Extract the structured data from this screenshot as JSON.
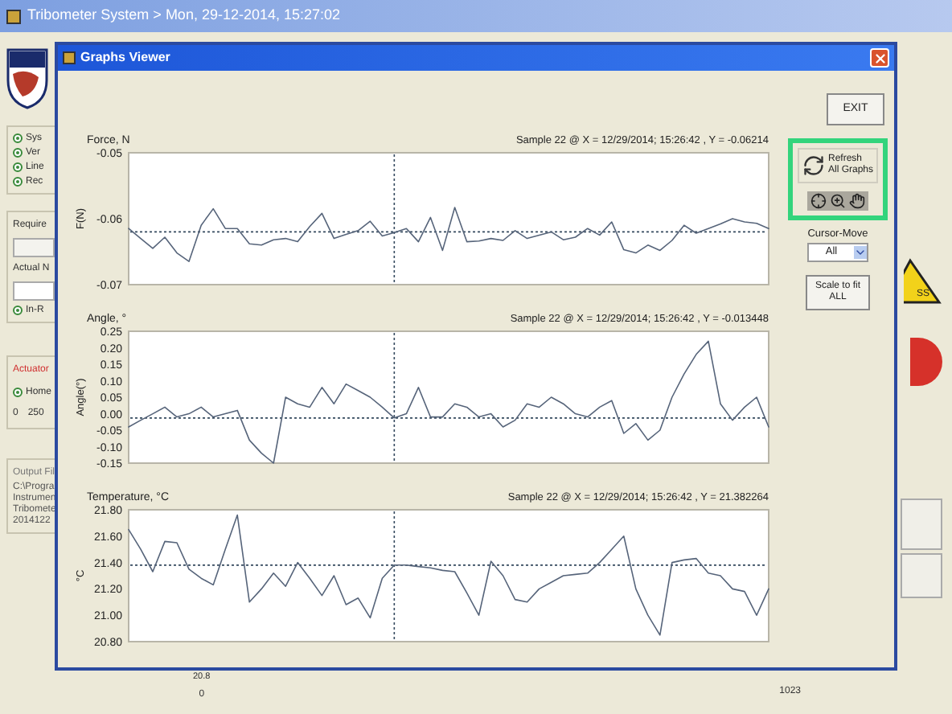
{
  "app_window": {
    "title": "Tribometer System > Mon, 29-12-2014, 15:27:02"
  },
  "background": {
    "status_options": [
      {
        "label": "Sys"
      },
      {
        "label": "Ver"
      },
      {
        "label": "Line"
      },
      {
        "label": "Rec"
      }
    ],
    "required_label": "Require",
    "actual_label": "Actual N",
    "in_range_option": "In-R",
    "actuator_label": "Actuator",
    "home_option": "Home",
    "slider_ticks": [
      "0",
      "250"
    ],
    "output_file_label": "Output Fil",
    "output_path_lines": [
      "C:\\Progra",
      "Instrumen",
      "Tribomete",
      "2014122"
    ],
    "warning_text": "SS",
    "bottom_axis_value": "20.8",
    "bottom_ticks": [
      "0",
      "1023"
    ]
  },
  "dialog": {
    "title": "Graphs Viewer",
    "graphs": [
      {
        "cursor_readout": "Sample 22 @ X = 12/29/2014; 15:26:42 , Y = -0.06214",
        "chart_data": {
          "type": "line",
          "title": "Force, N",
          "ylabel": "F(N)",
          "ylim": [
            -0.07,
            -0.05
          ],
          "yticks": [
            {
              "value": -0.07,
              "label": "-0.07"
            },
            {
              "value": -0.06,
              "label": "-0.06"
            },
            {
              "value": -0.05,
              "label": "-0.05"
            }
          ],
          "series": [
            {
              "color": "#56647a",
              "values": [
                -0.0615,
                -0.063,
                -0.0645,
                -0.0628,
                -0.0652,
                -0.0665,
                -0.061,
                -0.0585,
                -0.0615,
                -0.0615,
                -0.0638,
                -0.064,
                -0.0632,
                -0.063,
                -0.0635,
                -0.0612,
                -0.0592,
                -0.063,
                -0.0624,
                -0.0618,
                -0.0604,
                -0.0626,
                -0.0621,
                -0.0615,
                -0.0635,
                -0.0598,
                -0.0648,
                -0.0583,
                -0.0635,
                -0.0634,
                -0.063,
                -0.0633,
                -0.0618,
                -0.063,
                -0.0625,
                -0.062,
                -0.0632,
                -0.0628,
                -0.0615,
                -0.0625,
                -0.0605,
                -0.0647,
                -0.0652,
                -0.064,
                -0.0648,
                -0.0633,
                -0.061,
                -0.0622,
                -0.0615,
                -0.0608,
                -0.06,
                -0.0605,
                -0.0607,
                -0.0615
              ]
            }
          ],
          "ref_lines": [
            {
              "axis": "y",
              "value": -0.062
            }
          ]
        }
      },
      {
        "cursor_readout": "Sample 22 @ X = 12/29/2014; 15:26:42 , Y = -0.013448",
        "chart_data": {
          "type": "line",
          "title": "Angle, °",
          "ylabel": "Angle(°)",
          "ylim": [
            -0.15,
            0.25
          ],
          "yticks": [
            {
              "value": -0.15,
              "label": "-0.15"
            },
            {
              "value": -0.1,
              "label": "-0.10"
            },
            {
              "value": -0.05,
              "label": "-0.05"
            },
            {
              "value": 0,
              "label": "0.00"
            },
            {
              "value": 0.05,
              "label": "0.05"
            },
            {
              "value": 0.1,
              "label": "0.10"
            },
            {
              "value": 0.15,
              "label": "0.15"
            },
            {
              "value": 0.2,
              "label": "0.20"
            },
            {
              "value": 0.25,
              "label": "0.25"
            }
          ],
          "series": [
            {
              "color": "#56647a",
              "values": [
                -0.04,
                -0.02,
                0.0,
                0.02,
                -0.01,
                0.0,
                0.02,
                -0.01,
                0.0,
                0.01,
                -0.08,
                -0.12,
                -0.15,
                0.05,
                0.03,
                0.02,
                0.08,
                0.03,
                0.09,
                0.07,
                0.05,
                0.02,
                -0.013,
                0.0,
                0.08,
                -0.01,
                -0.01,
                0.03,
                0.02,
                -0.01,
                0.0,
                -0.04,
                -0.02,
                0.03,
                0.02,
                0.05,
                0.03,
                0.0,
                -0.01,
                0.02,
                0.04,
                -0.06,
                -0.03,
                -0.08,
                -0.05,
                0.05,
                0.12,
                0.18,
                0.22,
                0.03,
                -0.02,
                0.02,
                0.05,
                -0.04
              ]
            }
          ],
          "ref_lines": [
            {
              "axis": "y",
              "value": -0.013
            }
          ]
        }
      },
      {
        "cursor_readout": "Sample 22 @ X = 12/29/2014; 15:26:42 , Y = 21.382264",
        "chart_data": {
          "type": "line",
          "title": "Temperature, °C",
          "ylabel": "°C",
          "ylim": [
            20.8,
            21.8
          ],
          "yticks": [
            {
              "value": 20.8,
              "label": "20.80"
            },
            {
              "value": 21,
              "label": "21.00"
            },
            {
              "value": 21.2,
              "label": "21.20"
            },
            {
              "value": 21.4,
              "label": "21.40"
            },
            {
              "value": 21.6,
              "label": "21.60"
            },
            {
              "value": 21.8,
              "label": "21.80"
            }
          ],
          "series": [
            {
              "color": "#56647a",
              "values": [
                21.65,
                21.5,
                21.33,
                21.56,
                21.55,
                21.35,
                21.28,
                21.23,
                21.5,
                21.76,
                21.1,
                21.2,
                21.32,
                21.22,
                21.4,
                21.28,
                21.15,
                21.3,
                21.08,
                21.13,
                20.98,
                21.28,
                21.38,
                21.38,
                21.37,
                21.36,
                21.34,
                21.33,
                21.17,
                21.0,
                21.41,
                21.3,
                21.12,
                21.1,
                21.2,
                21.25,
                21.3,
                21.31,
                21.32,
                21.4,
                21.5,
                21.6,
                21.2,
                21.0,
                20.85,
                21.4,
                21.42,
                21.43,
                21.32,
                21.3,
                21.2,
                21.18,
                21.0,
                21.2
              ]
            }
          ],
          "ref_lines": [
            {
              "axis": "y",
              "value": 21.38
            }
          ]
        }
      }
    ],
    "panel": {
      "exit_button": "EXIT",
      "refresh_button": [
        "Refresh",
        "All Graphs"
      ],
      "cursor_move_label": "Cursor-Move",
      "cursor_move_value": "All",
      "scale_button": [
        "Scale to fit",
        "ALL"
      ]
    }
  }
}
